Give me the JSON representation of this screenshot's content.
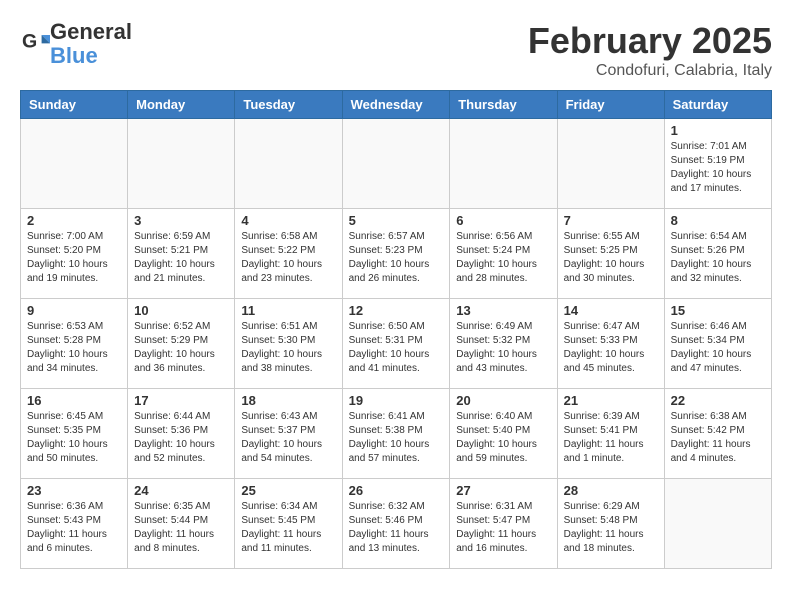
{
  "header": {
    "logo_general": "General",
    "logo_blue": "Blue",
    "month": "February 2025",
    "location": "Condofuri, Calabria, Italy"
  },
  "days_of_week": [
    "Sunday",
    "Monday",
    "Tuesday",
    "Wednesday",
    "Thursday",
    "Friday",
    "Saturday"
  ],
  "weeks": [
    [
      {
        "day": "",
        "info": ""
      },
      {
        "day": "",
        "info": ""
      },
      {
        "day": "",
        "info": ""
      },
      {
        "day": "",
        "info": ""
      },
      {
        "day": "",
        "info": ""
      },
      {
        "day": "",
        "info": ""
      },
      {
        "day": "1",
        "info": "Sunrise: 7:01 AM\nSunset: 5:19 PM\nDaylight: 10 hours\nand 17 minutes."
      }
    ],
    [
      {
        "day": "2",
        "info": "Sunrise: 7:00 AM\nSunset: 5:20 PM\nDaylight: 10 hours\nand 19 minutes."
      },
      {
        "day": "3",
        "info": "Sunrise: 6:59 AM\nSunset: 5:21 PM\nDaylight: 10 hours\nand 21 minutes."
      },
      {
        "day": "4",
        "info": "Sunrise: 6:58 AM\nSunset: 5:22 PM\nDaylight: 10 hours\nand 23 minutes."
      },
      {
        "day": "5",
        "info": "Sunrise: 6:57 AM\nSunset: 5:23 PM\nDaylight: 10 hours\nand 26 minutes."
      },
      {
        "day": "6",
        "info": "Sunrise: 6:56 AM\nSunset: 5:24 PM\nDaylight: 10 hours\nand 28 minutes."
      },
      {
        "day": "7",
        "info": "Sunrise: 6:55 AM\nSunset: 5:25 PM\nDaylight: 10 hours\nand 30 minutes."
      },
      {
        "day": "8",
        "info": "Sunrise: 6:54 AM\nSunset: 5:26 PM\nDaylight: 10 hours\nand 32 minutes."
      }
    ],
    [
      {
        "day": "9",
        "info": "Sunrise: 6:53 AM\nSunset: 5:28 PM\nDaylight: 10 hours\nand 34 minutes."
      },
      {
        "day": "10",
        "info": "Sunrise: 6:52 AM\nSunset: 5:29 PM\nDaylight: 10 hours\nand 36 minutes."
      },
      {
        "day": "11",
        "info": "Sunrise: 6:51 AM\nSunset: 5:30 PM\nDaylight: 10 hours\nand 38 minutes."
      },
      {
        "day": "12",
        "info": "Sunrise: 6:50 AM\nSunset: 5:31 PM\nDaylight: 10 hours\nand 41 minutes."
      },
      {
        "day": "13",
        "info": "Sunrise: 6:49 AM\nSunset: 5:32 PM\nDaylight: 10 hours\nand 43 minutes."
      },
      {
        "day": "14",
        "info": "Sunrise: 6:47 AM\nSunset: 5:33 PM\nDaylight: 10 hours\nand 45 minutes."
      },
      {
        "day": "15",
        "info": "Sunrise: 6:46 AM\nSunset: 5:34 PM\nDaylight: 10 hours\nand 47 minutes."
      }
    ],
    [
      {
        "day": "16",
        "info": "Sunrise: 6:45 AM\nSunset: 5:35 PM\nDaylight: 10 hours\nand 50 minutes."
      },
      {
        "day": "17",
        "info": "Sunrise: 6:44 AM\nSunset: 5:36 PM\nDaylight: 10 hours\nand 52 minutes."
      },
      {
        "day": "18",
        "info": "Sunrise: 6:43 AM\nSunset: 5:37 PM\nDaylight: 10 hours\nand 54 minutes."
      },
      {
        "day": "19",
        "info": "Sunrise: 6:41 AM\nSunset: 5:38 PM\nDaylight: 10 hours\nand 57 minutes."
      },
      {
        "day": "20",
        "info": "Sunrise: 6:40 AM\nSunset: 5:40 PM\nDaylight: 10 hours\nand 59 minutes."
      },
      {
        "day": "21",
        "info": "Sunrise: 6:39 AM\nSunset: 5:41 PM\nDaylight: 11 hours\nand 1 minute."
      },
      {
        "day": "22",
        "info": "Sunrise: 6:38 AM\nSunset: 5:42 PM\nDaylight: 11 hours\nand 4 minutes."
      }
    ],
    [
      {
        "day": "23",
        "info": "Sunrise: 6:36 AM\nSunset: 5:43 PM\nDaylight: 11 hours\nand 6 minutes."
      },
      {
        "day": "24",
        "info": "Sunrise: 6:35 AM\nSunset: 5:44 PM\nDaylight: 11 hours\nand 8 minutes."
      },
      {
        "day": "25",
        "info": "Sunrise: 6:34 AM\nSunset: 5:45 PM\nDaylight: 11 hours\nand 11 minutes."
      },
      {
        "day": "26",
        "info": "Sunrise: 6:32 AM\nSunset: 5:46 PM\nDaylight: 11 hours\nand 13 minutes."
      },
      {
        "day": "27",
        "info": "Sunrise: 6:31 AM\nSunset: 5:47 PM\nDaylight: 11 hours\nand 16 minutes."
      },
      {
        "day": "28",
        "info": "Sunrise: 6:29 AM\nSunset: 5:48 PM\nDaylight: 11 hours\nand 18 minutes."
      },
      {
        "day": "",
        "info": ""
      }
    ]
  ]
}
